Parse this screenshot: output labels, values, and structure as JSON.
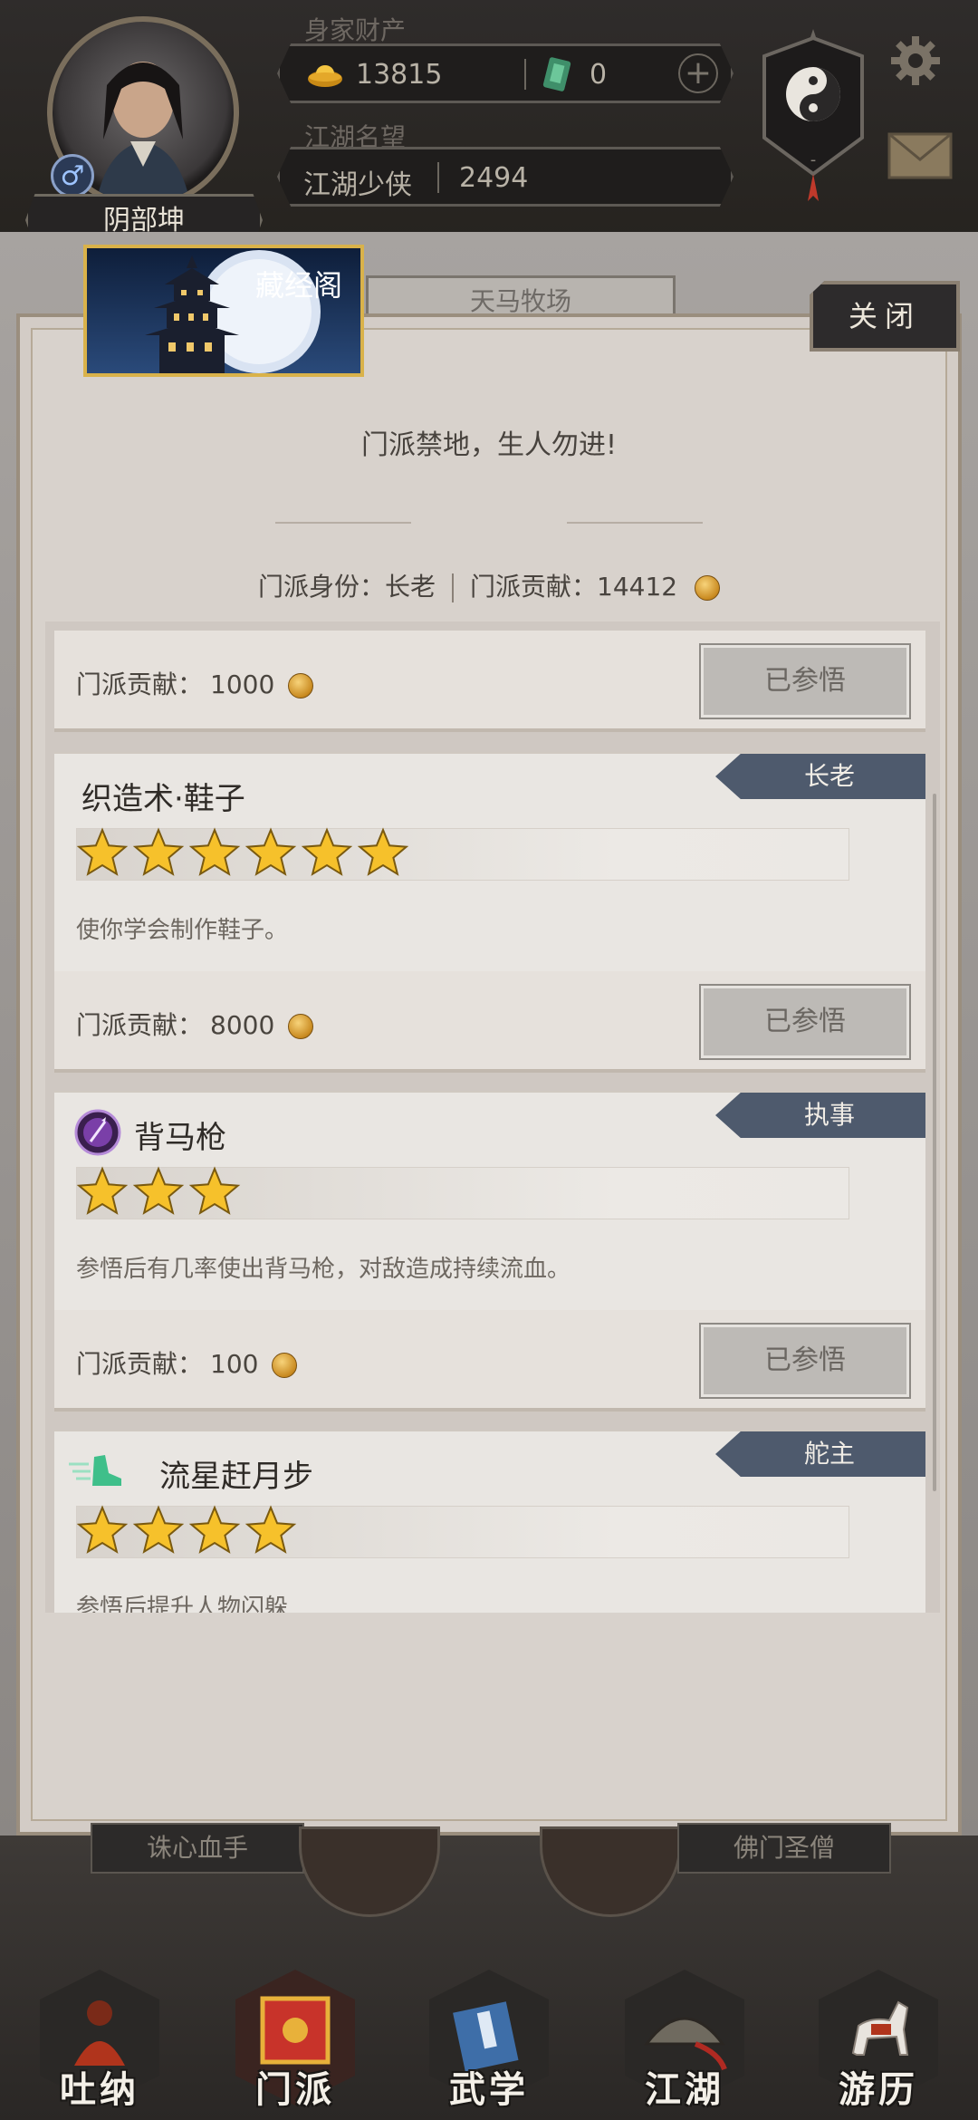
{
  "header": {
    "player_name": "阴部坤",
    "gender_icon": "male-icon",
    "wealth_label": "身家财产",
    "gold": "13815",
    "jade": "0",
    "fame_label": "江湖名望",
    "fame_title": "江湖少侠",
    "fame_value": "2494"
  },
  "background": {
    "tab_label": "天马牧场",
    "left_plate": "诛心血手",
    "right_plate": "佛门圣僧"
  },
  "modal": {
    "title": "藏经阁",
    "close_label": "关闭",
    "motto": "门派禁地，生人勿进!",
    "identity_label": "门派身份：长老",
    "contribution_label": "门派贡献：14412"
  },
  "skills": [
    {
      "cost_label": "门派贡献：",
      "cost": "1000",
      "button": "已参悟"
    },
    {
      "name": "织造术·鞋子",
      "icon": "none",
      "rank": "长老",
      "stars": 6,
      "description": "使你学会制作鞋子。",
      "cost_label": "门派贡献：",
      "cost": "8000",
      "button": "已参悟"
    },
    {
      "name": "背马枪",
      "icon": "spear-orb-icon",
      "rank": "执事",
      "stars": 3,
      "description": "参悟后有几率使出背马枪，对敌造成持续流血。",
      "cost_label": "门派贡献：",
      "cost": "100",
      "button": "已参悟"
    },
    {
      "name": "流星赶月步",
      "icon": "running-boot-icon",
      "rank": "舵主",
      "stars": 4,
      "description": "参悟后提升人物闪躲"
    }
  ],
  "nav": [
    {
      "label": "吐纳",
      "icon": "meditation-icon"
    },
    {
      "label": "门派",
      "icon": "sect-banner-icon",
      "active": true
    },
    {
      "label": "武学",
      "icon": "martial-book-icon"
    },
    {
      "label": "江湖",
      "icon": "bamboo-hat-icon"
    },
    {
      "label": "游历",
      "icon": "horse-icon"
    }
  ],
  "colors": {
    "rank_tag": "#4e5a6d",
    "title_border": "#d9b24a",
    "modal_bg": "#d8d2cc"
  }
}
